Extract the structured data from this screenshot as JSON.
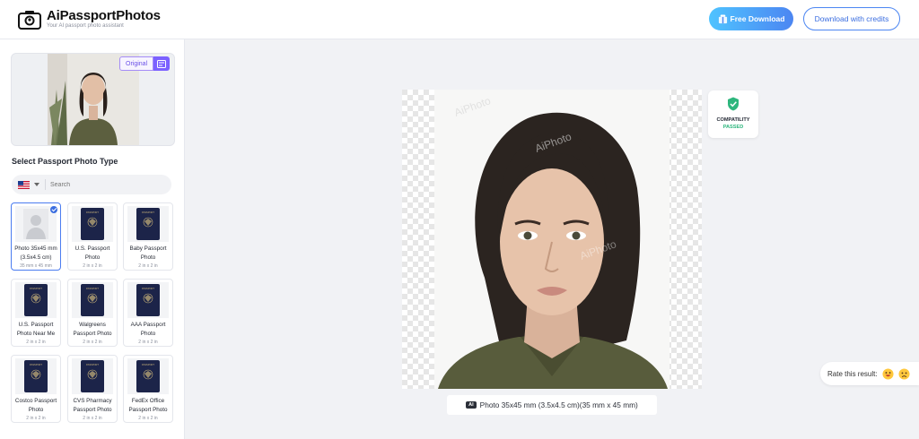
{
  "header": {
    "brand": "AiPassportPhotos",
    "tagline": "Your AI passport photo assistant",
    "free_download": "Free Download",
    "download_credits": "Download with credits"
  },
  "sidebar": {
    "original_label": "Original",
    "section_title": "Select Passport Photo Type",
    "search_placeholder": "Search",
    "types": [
      {
        "name": "Photo 35x45 mm (3.5x4.5 cm)",
        "size": "35 mm x 45 mm",
        "selected": true,
        "thumb": "silhouette"
      },
      {
        "name": "U.S. Passport Photo",
        "size": "2 in x 2 in",
        "selected": false,
        "thumb": "passport"
      },
      {
        "name": "Baby Passport Photo",
        "size": "2 in x 2 in",
        "selected": false,
        "thumb": "passport"
      },
      {
        "name": "U.S. Passport Photo Near Me",
        "size": "2 in x 2 in",
        "selected": false,
        "thumb": "passport"
      },
      {
        "name": "Walgreens Passport Photo",
        "size": "2 in x 2 in",
        "selected": false,
        "thumb": "passport"
      },
      {
        "name": "AAA Passport Photo",
        "size": "2 in x 2 in",
        "selected": false,
        "thumb": "passport"
      },
      {
        "name": "Costco Passport Photo",
        "size": "2 in x 2 in",
        "selected": false,
        "thumb": "passport"
      },
      {
        "name": "CVS Pharmacy Passport Photo",
        "size": "2 in x 2 in",
        "selected": false,
        "thumb": "passport"
      },
      {
        "name": "FedEx Office Passport Photo",
        "size": "2 in x 2 in",
        "selected": false,
        "thumb": "passport"
      }
    ]
  },
  "main": {
    "compat_line1": "COMPATILITY",
    "compat_line2": "PASSED",
    "ai_chip": "AI",
    "caption": "Photo 35x45 mm (3.5x4.5 cm)(35 mm x 45 mm)",
    "rate_label": "Rate this result:"
  },
  "colors": {
    "accent": "#4c86f2",
    "selected_border": "#4b7cf0",
    "passed": "#2eb67d",
    "original_badge": "#7b61ff"
  }
}
